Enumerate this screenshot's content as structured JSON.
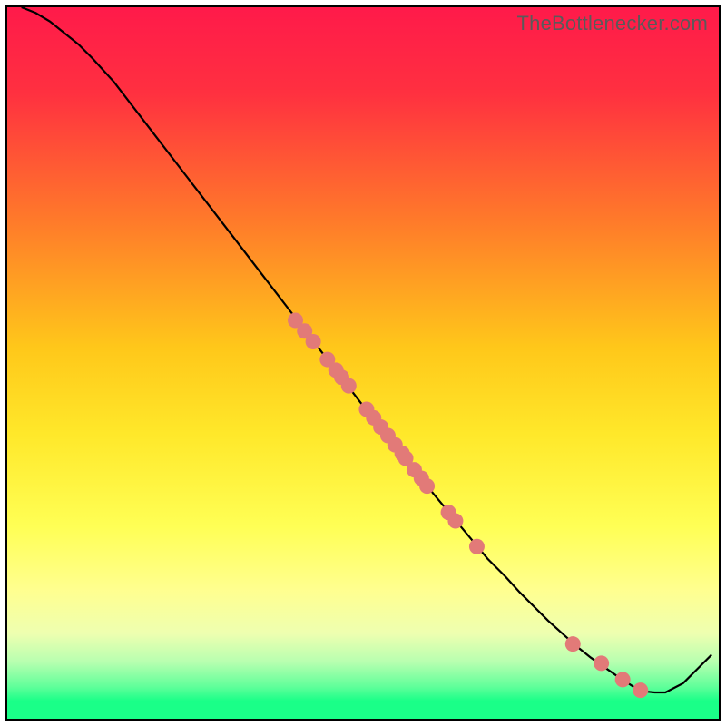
{
  "attribution": "TheBottlenecker.com",
  "colors": {
    "top": "#ff1a4a",
    "mid_upper": "#ff7a2a",
    "mid": "#ffe82a",
    "lower_yellow": "#ffff6a",
    "pale": "#f7ffb0",
    "green_light": "#7affa0",
    "green": "#1aff88",
    "line": "#000000",
    "dot_fill": "#e27a78",
    "dot_stroke": "#c25a58",
    "border": "#000000",
    "page_bg": "#ffffff"
  },
  "chart_data": {
    "type": "line",
    "title": "",
    "xlabel": "",
    "ylabel": "",
    "xlim": [
      0,
      100
    ],
    "ylim": [
      0,
      100
    ],
    "grid": false,
    "legend": null,
    "series": [
      {
        "name": "curve",
        "x": [
          2,
          4,
          6,
          8,
          10,
          12,
          15,
          20,
          25,
          30,
          35,
          40,
          45,
          50,
          55,
          60,
          62.5,
          65,
          67.5,
          70,
          72,
          74,
          76,
          78,
          80,
          82,
          84,
          86,
          88,
          89,
          90,
          91,
          92.5,
          95,
          97,
          99
        ],
        "y": [
          100,
          99.2,
          98.0,
          96.4,
          94.8,
          92.8,
          89.5,
          83.0,
          76.5,
          70.0,
          63.5,
          57.0,
          50.5,
          44.0,
          37.8,
          31.5,
          28.5,
          25.5,
          22.5,
          20.0,
          17.8,
          15.8,
          13.8,
          12.0,
          10.2,
          8.6,
          7.2,
          5.8,
          4.5,
          4.0,
          3.8,
          3.7,
          3.7,
          5.0,
          7.0,
          9.0
        ]
      }
    ],
    "points": [
      {
        "x": 40.5,
        "y": 56.0
      },
      {
        "x": 41.8,
        "y": 54.5
      },
      {
        "x": 43.0,
        "y": 53.0
      },
      {
        "x": 45.0,
        "y": 50.5
      },
      {
        "x": 46.2,
        "y": 49.0
      },
      {
        "x": 47.0,
        "y": 48.0
      },
      {
        "x": 48.0,
        "y": 46.8
      },
      {
        "x": 50.5,
        "y": 43.5
      },
      {
        "x": 51.5,
        "y": 42.3
      },
      {
        "x": 52.5,
        "y": 41.0
      },
      {
        "x": 53.5,
        "y": 39.8
      },
      {
        "x": 54.5,
        "y": 38.5
      },
      {
        "x": 55.5,
        "y": 37.3
      },
      {
        "x": 56.0,
        "y": 36.6
      },
      {
        "x": 57.2,
        "y": 35.0
      },
      {
        "x": 58.2,
        "y": 33.8
      },
      {
        "x": 59.0,
        "y": 32.7
      },
      {
        "x": 62.0,
        "y": 29.0
      },
      {
        "x": 63.0,
        "y": 27.8
      },
      {
        "x": 66.0,
        "y": 24.2
      },
      {
        "x": 79.5,
        "y": 10.5
      },
      {
        "x": 83.5,
        "y": 7.8
      },
      {
        "x": 86.5,
        "y": 5.5
      },
      {
        "x": 89.0,
        "y": 4.0
      }
    ],
    "gradient_stops": [
      {
        "offset": 0.0,
        "color": "#ff1a4a"
      },
      {
        "offset": 0.12,
        "color": "#ff3040"
      },
      {
        "offset": 0.3,
        "color": "#ff7a2a"
      },
      {
        "offset": 0.48,
        "color": "#ffc81a"
      },
      {
        "offset": 0.6,
        "color": "#ffe82a"
      },
      {
        "offset": 0.73,
        "color": "#ffff55"
      },
      {
        "offset": 0.82,
        "color": "#ffff90"
      },
      {
        "offset": 0.88,
        "color": "#eeffb0"
      },
      {
        "offset": 0.92,
        "color": "#b8ffb0"
      },
      {
        "offset": 0.955,
        "color": "#60ff9a"
      },
      {
        "offset": 0.975,
        "color": "#1aff88"
      },
      {
        "offset": 1.0,
        "color": "#1aff88"
      }
    ]
  }
}
